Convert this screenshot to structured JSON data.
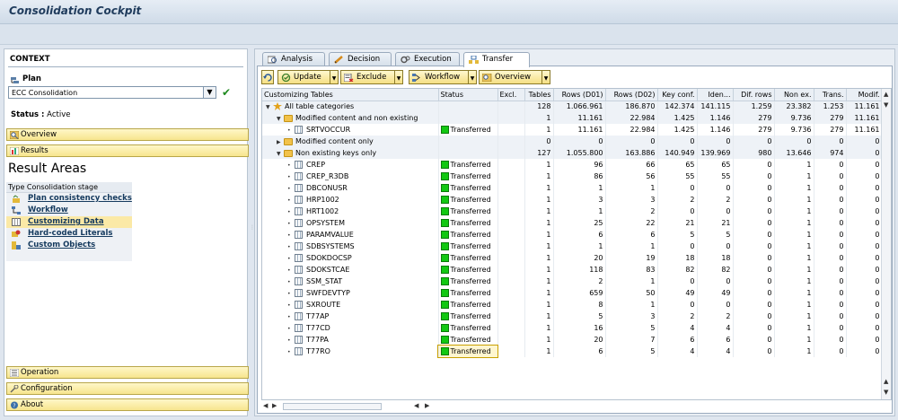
{
  "app": {
    "title": "Consolidation Cockpit"
  },
  "context": {
    "header": "CONTEXT",
    "plan_label": "Plan",
    "plan_value": "ECC Consolidation",
    "status_label": "Status :",
    "status_value": "Active"
  },
  "nav": {
    "overview": "Overview",
    "results": "Results",
    "operation": "Operation",
    "configuration": "Configuration",
    "about": "About"
  },
  "result_areas": {
    "title": "Result Areas",
    "header": "Type Consolidation stage",
    "items": [
      {
        "label": "Plan consistency checks",
        "icon": "checklist-icon",
        "active": false
      },
      {
        "label": "Workflow",
        "icon": "workflow-icon",
        "active": false
      },
      {
        "label": "Customizing Data",
        "icon": "table-icon",
        "active": true
      },
      {
        "label": "Hard-coded Literals",
        "icon": "literal-icon",
        "active": false
      },
      {
        "label": "Custom Objects",
        "icon": "object-icon",
        "active": false
      }
    ]
  },
  "tabs": [
    {
      "label": "Analysis",
      "icon": "analysis-icon"
    },
    {
      "label": "Decision",
      "icon": "decision-icon"
    },
    {
      "label": "Execution",
      "icon": "execution-icon"
    },
    {
      "label": "Transfer",
      "icon": "transfer-icon",
      "active": true
    }
  ],
  "toolbar": {
    "update": "Update",
    "exclude": "Exclude",
    "workflow": "Workflow",
    "overview": "Overview"
  },
  "table": {
    "columns": [
      "Customizing Tables",
      "Status",
      "Excl.",
      "Tables",
      "Rows (D01)",
      "Rows (D02)",
      "Key conf.",
      "Iden...",
      "Dif. rows",
      "Non ex.",
      "Trans.",
      "Modif."
    ],
    "rows": [
      {
        "level": 0,
        "kind": "root",
        "name": "All table categories",
        "status": "",
        "excl": "",
        "tables": "128",
        "rows_d01": "1.066.961",
        "rows_d02": "186.870",
        "key_conf": "142.374",
        "iden": "141.115",
        "dif_rows": "1.259",
        "non_ex": "23.382",
        "trans": "1.253",
        "modif": "11.161"
      },
      {
        "level": 1,
        "kind": "folder-open",
        "name": "Modified content and non existing",
        "status": "",
        "excl": "",
        "tables": "1",
        "rows_d01": "11.161",
        "rows_d02": "22.984",
        "key_conf": "1.425",
        "iden": "1.146",
        "dif_rows": "279",
        "non_ex": "9.736",
        "trans": "279",
        "modif": "11.161"
      },
      {
        "level": 2,
        "kind": "table",
        "name": "SRTVOCCUR",
        "status": "Transferred",
        "excl": "",
        "tables": "1",
        "rows_d01": "11.161",
        "rows_d02": "22.984",
        "key_conf": "1.425",
        "iden": "1.146",
        "dif_rows": "279",
        "non_ex": "9.736",
        "trans": "279",
        "modif": "11.161"
      },
      {
        "level": 1,
        "kind": "folder",
        "name": "Modified content only",
        "status": "",
        "excl": "",
        "tables": "0",
        "rows_d01": "0",
        "rows_d02": "0",
        "key_conf": "0",
        "iden": "0",
        "dif_rows": "0",
        "non_ex": "0",
        "trans": "0",
        "modif": "0"
      },
      {
        "level": 1,
        "kind": "folder-open",
        "name": "Non existing keys only",
        "status": "",
        "excl": "",
        "tables": "127",
        "rows_d01": "1.055.800",
        "rows_d02": "163.886",
        "key_conf": "140.949",
        "iden": "139.969",
        "dif_rows": "980",
        "non_ex": "13.646",
        "trans": "974",
        "modif": "0"
      },
      {
        "level": 2,
        "kind": "table",
        "name": "CREP",
        "status": "Transferred",
        "excl": "",
        "tables": "1",
        "rows_d01": "96",
        "rows_d02": "66",
        "key_conf": "65",
        "iden": "65",
        "dif_rows": "0",
        "non_ex": "1",
        "trans": "0",
        "modif": "0"
      },
      {
        "level": 2,
        "kind": "table",
        "name": "CREP_R3DB",
        "status": "Transferred",
        "excl": "",
        "tables": "1",
        "rows_d01": "86",
        "rows_d02": "56",
        "key_conf": "55",
        "iden": "55",
        "dif_rows": "0",
        "non_ex": "1",
        "trans": "0",
        "modif": "0"
      },
      {
        "level": 2,
        "kind": "table",
        "name": "DBCONUSR",
        "status": "Transferred",
        "excl": "",
        "tables": "1",
        "rows_d01": "1",
        "rows_d02": "1",
        "key_conf": "0",
        "iden": "0",
        "dif_rows": "0",
        "non_ex": "1",
        "trans": "0",
        "modif": "0"
      },
      {
        "level": 2,
        "kind": "table",
        "name": "HRP1002",
        "status": "Transferred",
        "excl": "",
        "tables": "1",
        "rows_d01": "3",
        "rows_d02": "3",
        "key_conf": "2",
        "iden": "2",
        "dif_rows": "0",
        "non_ex": "1",
        "trans": "0",
        "modif": "0"
      },
      {
        "level": 2,
        "kind": "table",
        "name": "HRT1002",
        "status": "Transferred",
        "excl": "",
        "tables": "1",
        "rows_d01": "1",
        "rows_d02": "2",
        "key_conf": "0",
        "iden": "0",
        "dif_rows": "0",
        "non_ex": "1",
        "trans": "0",
        "modif": "0"
      },
      {
        "level": 2,
        "kind": "table",
        "name": "OPSYSTEM",
        "status": "Transferred",
        "excl": "",
        "tables": "1",
        "rows_d01": "25",
        "rows_d02": "22",
        "key_conf": "21",
        "iden": "21",
        "dif_rows": "0",
        "non_ex": "1",
        "trans": "0",
        "modif": "0"
      },
      {
        "level": 2,
        "kind": "table",
        "name": "PARAMVALUE",
        "status": "Transferred",
        "excl": "",
        "tables": "1",
        "rows_d01": "6",
        "rows_d02": "6",
        "key_conf": "5",
        "iden": "5",
        "dif_rows": "0",
        "non_ex": "1",
        "trans": "0",
        "modif": "0"
      },
      {
        "level": 2,
        "kind": "table",
        "name": "SDBSYSTEMS",
        "status": "Transferred",
        "excl": "",
        "tables": "1",
        "rows_d01": "1",
        "rows_d02": "1",
        "key_conf": "0",
        "iden": "0",
        "dif_rows": "0",
        "non_ex": "1",
        "trans": "0",
        "modif": "0"
      },
      {
        "level": 2,
        "kind": "table",
        "name": "SDOKDOCSP",
        "status": "Transferred",
        "excl": "",
        "tables": "1",
        "rows_d01": "20",
        "rows_d02": "19",
        "key_conf": "18",
        "iden": "18",
        "dif_rows": "0",
        "non_ex": "1",
        "trans": "0",
        "modif": "0"
      },
      {
        "level": 2,
        "kind": "table",
        "name": "SDOKSTCAE",
        "status": "Transferred",
        "excl": "",
        "tables": "1",
        "rows_d01": "118",
        "rows_d02": "83",
        "key_conf": "82",
        "iden": "82",
        "dif_rows": "0",
        "non_ex": "1",
        "trans": "0",
        "modif": "0"
      },
      {
        "level": 2,
        "kind": "table",
        "name": "SSM_STAT",
        "status": "Transferred",
        "excl": "",
        "tables": "1",
        "rows_d01": "2",
        "rows_d02": "1",
        "key_conf": "0",
        "iden": "0",
        "dif_rows": "0",
        "non_ex": "1",
        "trans": "0",
        "modif": "0"
      },
      {
        "level": 2,
        "kind": "table",
        "name": "SWFDEVTYP",
        "status": "Transferred",
        "excl": "",
        "tables": "1",
        "rows_d01": "659",
        "rows_d02": "50",
        "key_conf": "49",
        "iden": "49",
        "dif_rows": "0",
        "non_ex": "1",
        "trans": "0",
        "modif": "0"
      },
      {
        "level": 2,
        "kind": "table",
        "name": "SXROUTE",
        "status": "Transferred",
        "excl": "",
        "tables": "1",
        "rows_d01": "8",
        "rows_d02": "1",
        "key_conf": "0",
        "iden": "0",
        "dif_rows": "0",
        "non_ex": "1",
        "trans": "0",
        "modif": "0"
      },
      {
        "level": 2,
        "kind": "table",
        "name": "T77AP",
        "status": "Transferred",
        "excl": "",
        "tables": "1",
        "rows_d01": "5",
        "rows_d02": "3",
        "key_conf": "2",
        "iden": "2",
        "dif_rows": "0",
        "non_ex": "1",
        "trans": "0",
        "modif": "0"
      },
      {
        "level": 2,
        "kind": "table",
        "name": "T77CD",
        "status": "Transferred",
        "excl": "",
        "tables": "1",
        "rows_d01": "16",
        "rows_d02": "5",
        "key_conf": "4",
        "iden": "4",
        "dif_rows": "0",
        "non_ex": "1",
        "trans": "0",
        "modif": "0"
      },
      {
        "level": 2,
        "kind": "table",
        "name": "T77PA",
        "status": "Transferred",
        "excl": "",
        "tables": "1",
        "rows_d01": "20",
        "rows_d02": "7",
        "key_conf": "6",
        "iden": "6",
        "dif_rows": "0",
        "non_ex": "1",
        "trans": "0",
        "modif": "0"
      },
      {
        "level": 2,
        "kind": "table",
        "name": "T77RO",
        "status": "Transferred",
        "excl": "",
        "tables": "1",
        "rows_d01": "6",
        "rows_d02": "5",
        "key_conf": "4",
        "iden": "4",
        "dif_rows": "0",
        "non_ex": "1",
        "trans": "0",
        "modif": "0",
        "focused": true
      }
    ]
  },
  "colors": {
    "status_green": "#12c812",
    "nav_yellow": "#f7e58e",
    "title_blue": "#1f3b5c"
  }
}
